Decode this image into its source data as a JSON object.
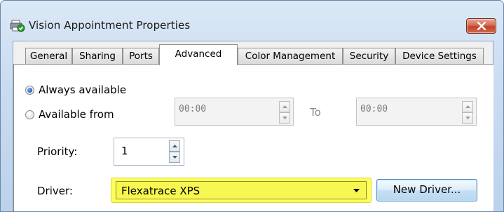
{
  "window": {
    "title": "Vision Appointment Properties"
  },
  "tabs": [
    {
      "label": "General",
      "active": false
    },
    {
      "label": "Sharing",
      "active": false
    },
    {
      "label": "Ports",
      "active": false
    },
    {
      "label": "Advanced",
      "active": true
    },
    {
      "label": "Color Management",
      "active": false
    },
    {
      "label": "Security",
      "active": false
    },
    {
      "label": "Device Settings",
      "active": false
    }
  ],
  "advanced": {
    "availability": {
      "always_label": "Always available",
      "always_checked": true,
      "from_label": "Available from",
      "from_checked": false,
      "from_time": "00:00",
      "to_label": "To",
      "to_time": "00:00"
    },
    "priority": {
      "label": "Priority:",
      "value": "1"
    },
    "driver": {
      "label": "Driver:",
      "selected": "Flexatrace XPS",
      "highlight_color": "#ffff5a",
      "new_driver_label": "New Driver..."
    }
  },
  "icons": {
    "app": "printer-check-icon",
    "close": "close-icon",
    "spin_up": "chevron-up-icon",
    "spin_down": "chevron-down-icon",
    "dropdown": "dropdown-arrow-icon"
  }
}
